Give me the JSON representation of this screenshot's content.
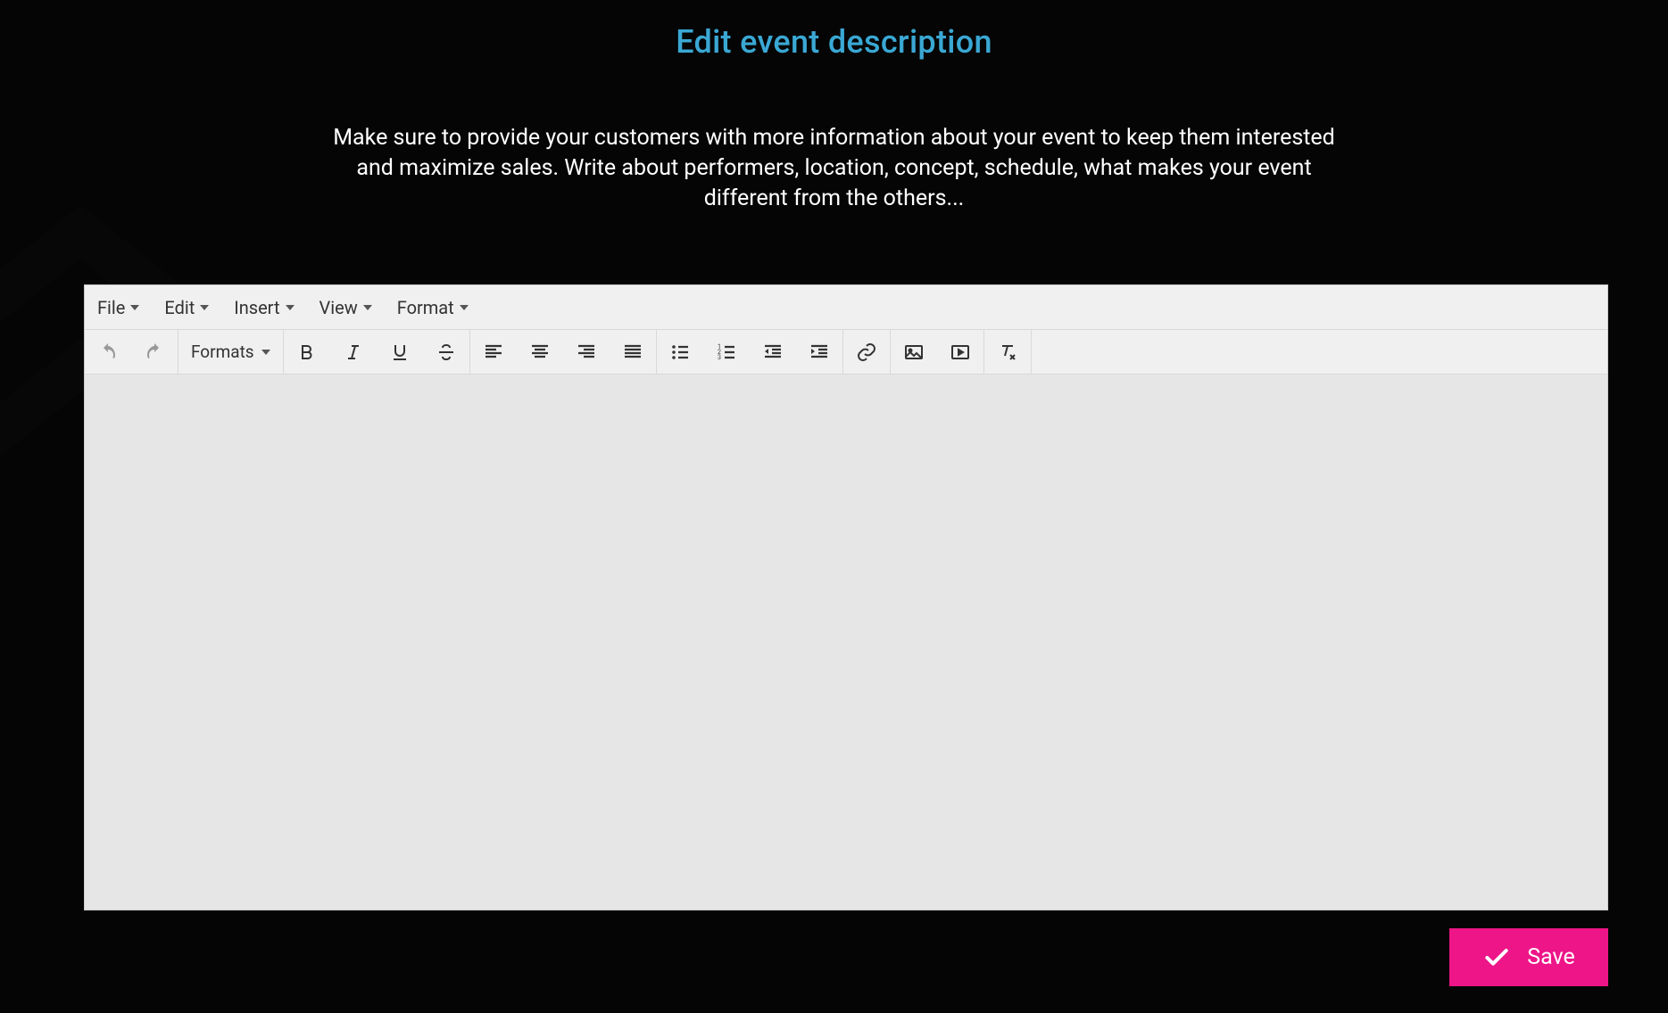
{
  "title": "Edit event description",
  "subtitle": "Make sure to provide your customers with more information about your event to keep them interested and maximize sales. Write about performers, location, concept, schedule, what makes your event different from the others...",
  "menubar": {
    "file": "File",
    "edit": "Edit",
    "insert": "Insert",
    "view": "View",
    "format": "Format"
  },
  "toolbar": {
    "formats_label": "Formats"
  },
  "save_button": {
    "label": "Save"
  },
  "editor": {
    "content": ""
  }
}
